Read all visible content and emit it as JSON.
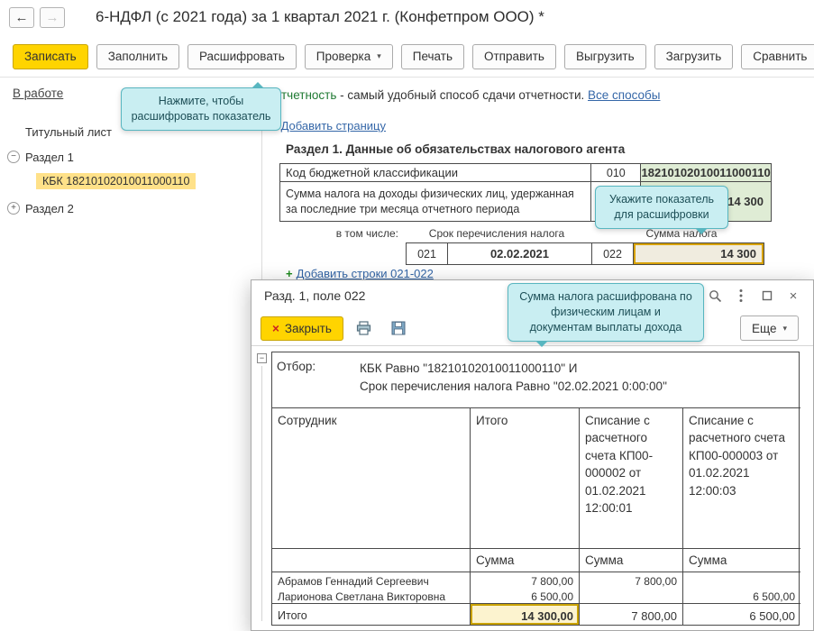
{
  "titlebar": {
    "title": "6-НДФЛ (с 2021 года) за 1 квартал 2021 г. (Конфетпром ООО) *"
  },
  "toolbar": {
    "buttons": [
      "Записать",
      "Заполнить",
      "Расшифровать",
      "Проверка",
      "Печать",
      "Отправить",
      "Выгрузить",
      "Загрузить",
      "Сравнить"
    ]
  },
  "status": {
    "state_link": "В работе",
    "promo_fragment": "тчетность",
    "promo_text": " - самый удобный способ сдачи отчетности. ",
    "promo_link": "Все способы"
  },
  "hints": {
    "hint_toolbar": "Нажмите, чтобы\nрасшифровать показатель",
    "hint_cell": "Укажите показатель\nдля расшифровки",
    "hint_popup": "Сумма налога расшифрована по\nфизическим лицам и\nдокументам выплаты дохода"
  },
  "tree": {
    "items": [
      "Титульный лист",
      "Раздел 1",
      "КБК 18210102010011000110",
      "Раздел 2"
    ]
  },
  "report": {
    "add_page_link": "Добавить страницу",
    "section_header": "Раздел 1. Данные об обязательствах налогового агента",
    "kbk_row": {
      "label": "Код бюджетной классификации",
      "code": "010",
      "value": "18210102010011000110"
    },
    "sum_row": {
      "label": "Сумма налога на доходы физических лиц, удержанная\nза последние три месяца отчетного периода",
      "value": "14 300"
    },
    "subheader": {
      "left": "в том числе:",
      "term": "Срок перечисления налога",
      "amount": "Сумма налога"
    },
    "line_row": {
      "code1": "021",
      "date": "02.02.2021",
      "code2": "022",
      "value": "14 300"
    },
    "add_lines_link": "Добавить строки 021-022"
  },
  "popup": {
    "title": "Разд. 1, поле 022",
    "close_button": "Закрыть",
    "more_button": "Еще",
    "filter_label": "Отбор:",
    "filter_value": "КБК Равно \"18210102010011000110\" И\nСрок перечисления налога Равно \"02.02.2021 0:00:00\"",
    "table": {
      "columns": {
        "employee": "Сотрудник",
        "total": "Итого",
        "doc1": "Списание с расчетного счета КП00-000002 от 01.02.2021 12:00:01",
        "doc2": "Списание с расчетного счета КП00-000003 от 01.02.2021 12:00:03"
      },
      "amount_label": "Сумма",
      "rows": [
        {
          "name": "Абрамов Геннадий Сергеевич",
          "total": "7 800,00",
          "doc1": "7 800,00",
          "doc2": ""
        },
        {
          "name": "Ларионова Светлана Викторовна",
          "total": "6 500,00",
          "doc1": "",
          "doc2": "6 500,00"
        }
      ],
      "total_row": {
        "name": "Итого",
        "total": "14 300,00",
        "doc1": "7 800,00",
        "doc2": "6 500,00"
      }
    }
  },
  "icons": {
    "back": "←",
    "forward": "→",
    "dropdown": "▾",
    "add": "+",
    "close": "×",
    "collapse": "−",
    "expand": "+",
    "group": "−"
  },
  "colors": {
    "accent_yellow": "#ffd400",
    "hint_bg": "#c9eef2",
    "hint_border": "#58b6c0",
    "green_cell": "#dfecd5",
    "selection_gold": "#d8a200",
    "selected_tree_bg": "#ffe189",
    "link_blue": "#3567a8",
    "plus_green": "#1d8a1d"
  }
}
